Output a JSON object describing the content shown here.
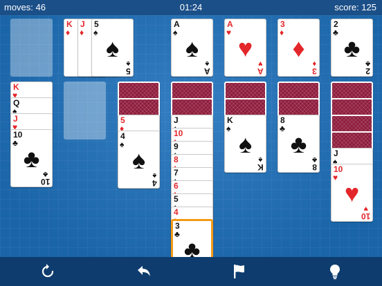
{
  "header": {
    "moves": "moves: 46",
    "time": "01:24",
    "score": "score: 125"
  },
  "icons": {
    "restart": "restart-icon",
    "undo": "undo-icon",
    "flag": "flag-icon",
    "hint": "lightbulb-icon"
  },
  "colors": {
    "top_bar": "#1b4f88",
    "felt": "#1d70bb",
    "bottom_bar": "#0e3c6e",
    "card_back": "#8e1c3c",
    "red_suit": "#e3262a",
    "selection": "#f59a17"
  },
  "glyphs": {
    "spade": "♠",
    "heart": "♥",
    "diamond": "♦",
    "club": "♣"
  },
  "stock": {
    "empty": true
  },
  "waste": [
    {
      "rank": "K",
      "suit": "diamond"
    },
    {
      "rank": "J",
      "suit": "diamond"
    },
    {
      "rank": "5",
      "suit": "spade"
    }
  ],
  "foundations": [
    {
      "rank": "A",
      "suit": "spade"
    },
    {
      "rank": "A",
      "suit": "heart"
    },
    {
      "rank": "3",
      "suit": "diamond"
    },
    {
      "rank": "2",
      "suit": "club"
    }
  ],
  "tableau": [
    {
      "face_down": 0,
      "cards": [
        {
          "rank": "K",
          "suit": "heart"
        },
        {
          "rank": "Q",
          "suit": "spade"
        },
        {
          "rank": "J",
          "suit": "heart"
        },
        {
          "rank": "10",
          "suit": "club"
        }
      ]
    },
    {
      "face_down": 0,
      "empty": true,
      "cards": []
    },
    {
      "face_down": 2,
      "cards": [
        {
          "rank": "5",
          "suit": "diamond"
        },
        {
          "rank": "4",
          "suit": "spade"
        }
      ]
    },
    {
      "face_down": 2,
      "cards": [
        {
          "rank": "J",
          "suit": "spade"
        },
        {
          "rank": "10",
          "suit": "diamond"
        },
        {
          "rank": "9",
          "suit": "spade"
        },
        {
          "rank": "8",
          "suit": "diamond"
        },
        {
          "rank": "7",
          "suit": "spade"
        },
        {
          "rank": "6",
          "suit": "diamond"
        },
        {
          "rank": "5",
          "suit": "spade"
        },
        {
          "rank": "4",
          "suit": "diamond"
        },
        {
          "rank": "3",
          "suit": "club",
          "selected": true
        }
      ]
    },
    {
      "face_down": 2,
      "cards": [
        {
          "rank": "K",
          "suit": "spade"
        }
      ]
    },
    {
      "face_down": 2,
      "cards": [
        {
          "rank": "8",
          "suit": "club"
        }
      ]
    },
    {
      "face_down": 4,
      "cards": [
        {
          "rank": "J",
          "suit": "spade"
        },
        {
          "rank": "10",
          "suit": "heart"
        }
      ]
    }
  ]
}
